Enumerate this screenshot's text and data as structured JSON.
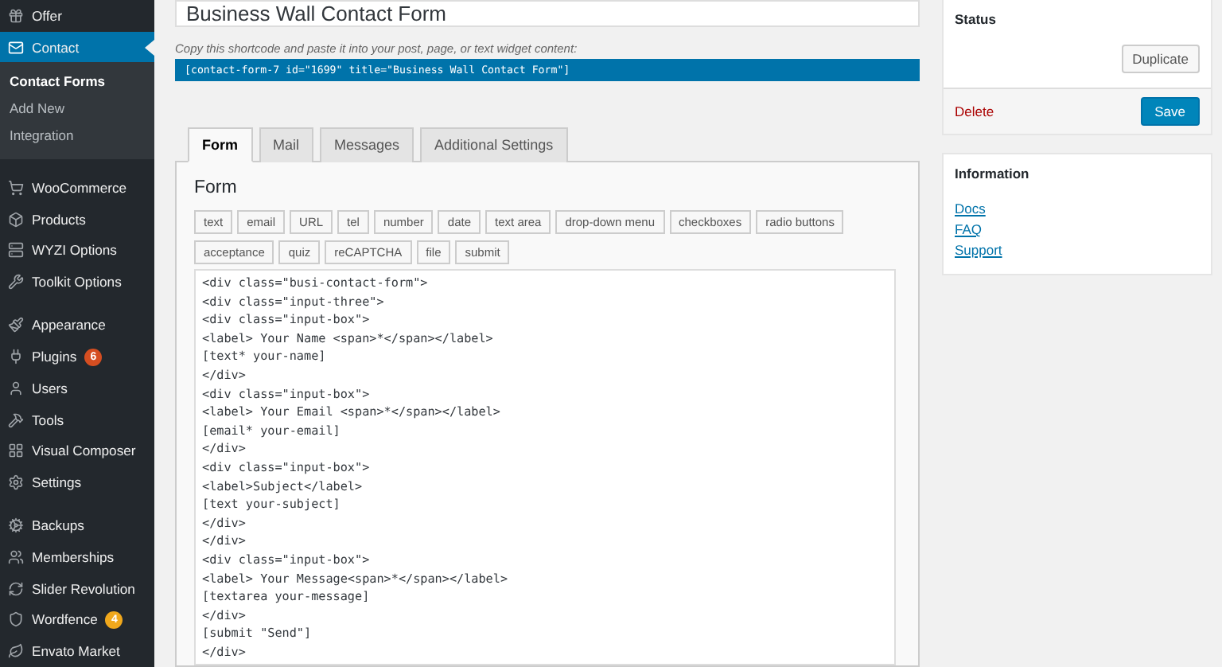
{
  "sidebar": {
    "items": [
      {
        "label": "Offer",
        "selected": false
      },
      {
        "label": "Contact",
        "selected": true,
        "children": [
          {
            "label": "Contact Forms",
            "selected": true
          },
          {
            "label": "Add New",
            "selected": false
          },
          {
            "label": "Integration",
            "selected": false
          }
        ]
      },
      {
        "kind": "separator"
      },
      {
        "label": "WooCommerce",
        "selected": false
      },
      {
        "label": "Products",
        "selected": false
      },
      {
        "label": "WYZI Options",
        "selected": false
      },
      {
        "label": "Toolkit Options",
        "selected": false
      },
      {
        "kind": "separator"
      },
      {
        "label": "Appearance",
        "selected": false
      },
      {
        "label": "Plugins",
        "selected": false,
        "badge": "6",
        "color": "#d54e21"
      },
      {
        "label": "Users",
        "selected": false
      },
      {
        "label": "Tools",
        "selected": false
      },
      {
        "label": "Visual Composer",
        "selected": false
      },
      {
        "label": "Settings",
        "selected": false
      },
      {
        "kind": "separator"
      },
      {
        "label": "Backups",
        "selected": false
      },
      {
        "label": "Memberships",
        "selected": false
      },
      {
        "label": "Slider Revolution",
        "selected": false
      },
      {
        "label": "Wordfence",
        "selected": false,
        "badge": "4",
        "color": "#f0a81c"
      },
      {
        "label": "Envato Market",
        "selected": false
      }
    ]
  },
  "editor": {
    "title": "Business Wall Contact Form",
    "shortcode_hint": "Copy this shortcode and paste it into your post, page, or text widget content:",
    "shortcode": "[contact-form-7 id=\"1699\" title=\"Business Wall Contact Form\"]",
    "tabs": [
      {
        "label": "Form",
        "selected": true
      },
      {
        "label": "Mail",
        "selected": false
      },
      {
        "label": "Messages",
        "selected": false
      },
      {
        "label": "Additional Settings",
        "selected": false
      }
    ],
    "section_title": "Form",
    "tag_buttons": [
      "text",
      "email",
      "URL",
      "tel",
      "number",
      "date",
      "text area",
      "drop-down menu",
      "checkboxes",
      "radio buttons",
      "acceptance",
      "quiz",
      "reCAPTCHA",
      "file",
      "submit"
    ],
    "code_lines": [
      "<div class=\"busi-contact-form\">",
      "<div class=\"input-three\">",
      "<div class=\"input-box\">",
      "<label> Your Name <span>*</span></label>",
      "[text* your-name]",
      "</div>",
      "<div class=\"input-box\">",
      "<label> Your Email <span>*</span></label>",
      "[email* your-email]",
      "</div>",
      "<div class=\"input-box\">",
      "<label>Subject</label>",
      "[text your-subject]",
      "</div>",
      "</div>",
      "<div class=\"input-box\">",
      "<label> Your Message<span>*</span></label>",
      "[textarea your-message]",
      "</div>",
      "[submit \"Send\"]",
      "</div>"
    ]
  },
  "status_box": {
    "title": "Status",
    "duplicate": "Duplicate",
    "delete": "Delete",
    "save": "Save"
  },
  "info_box": {
    "title": "Information",
    "links": [
      "Docs",
      "FAQ",
      "Support"
    ]
  }
}
